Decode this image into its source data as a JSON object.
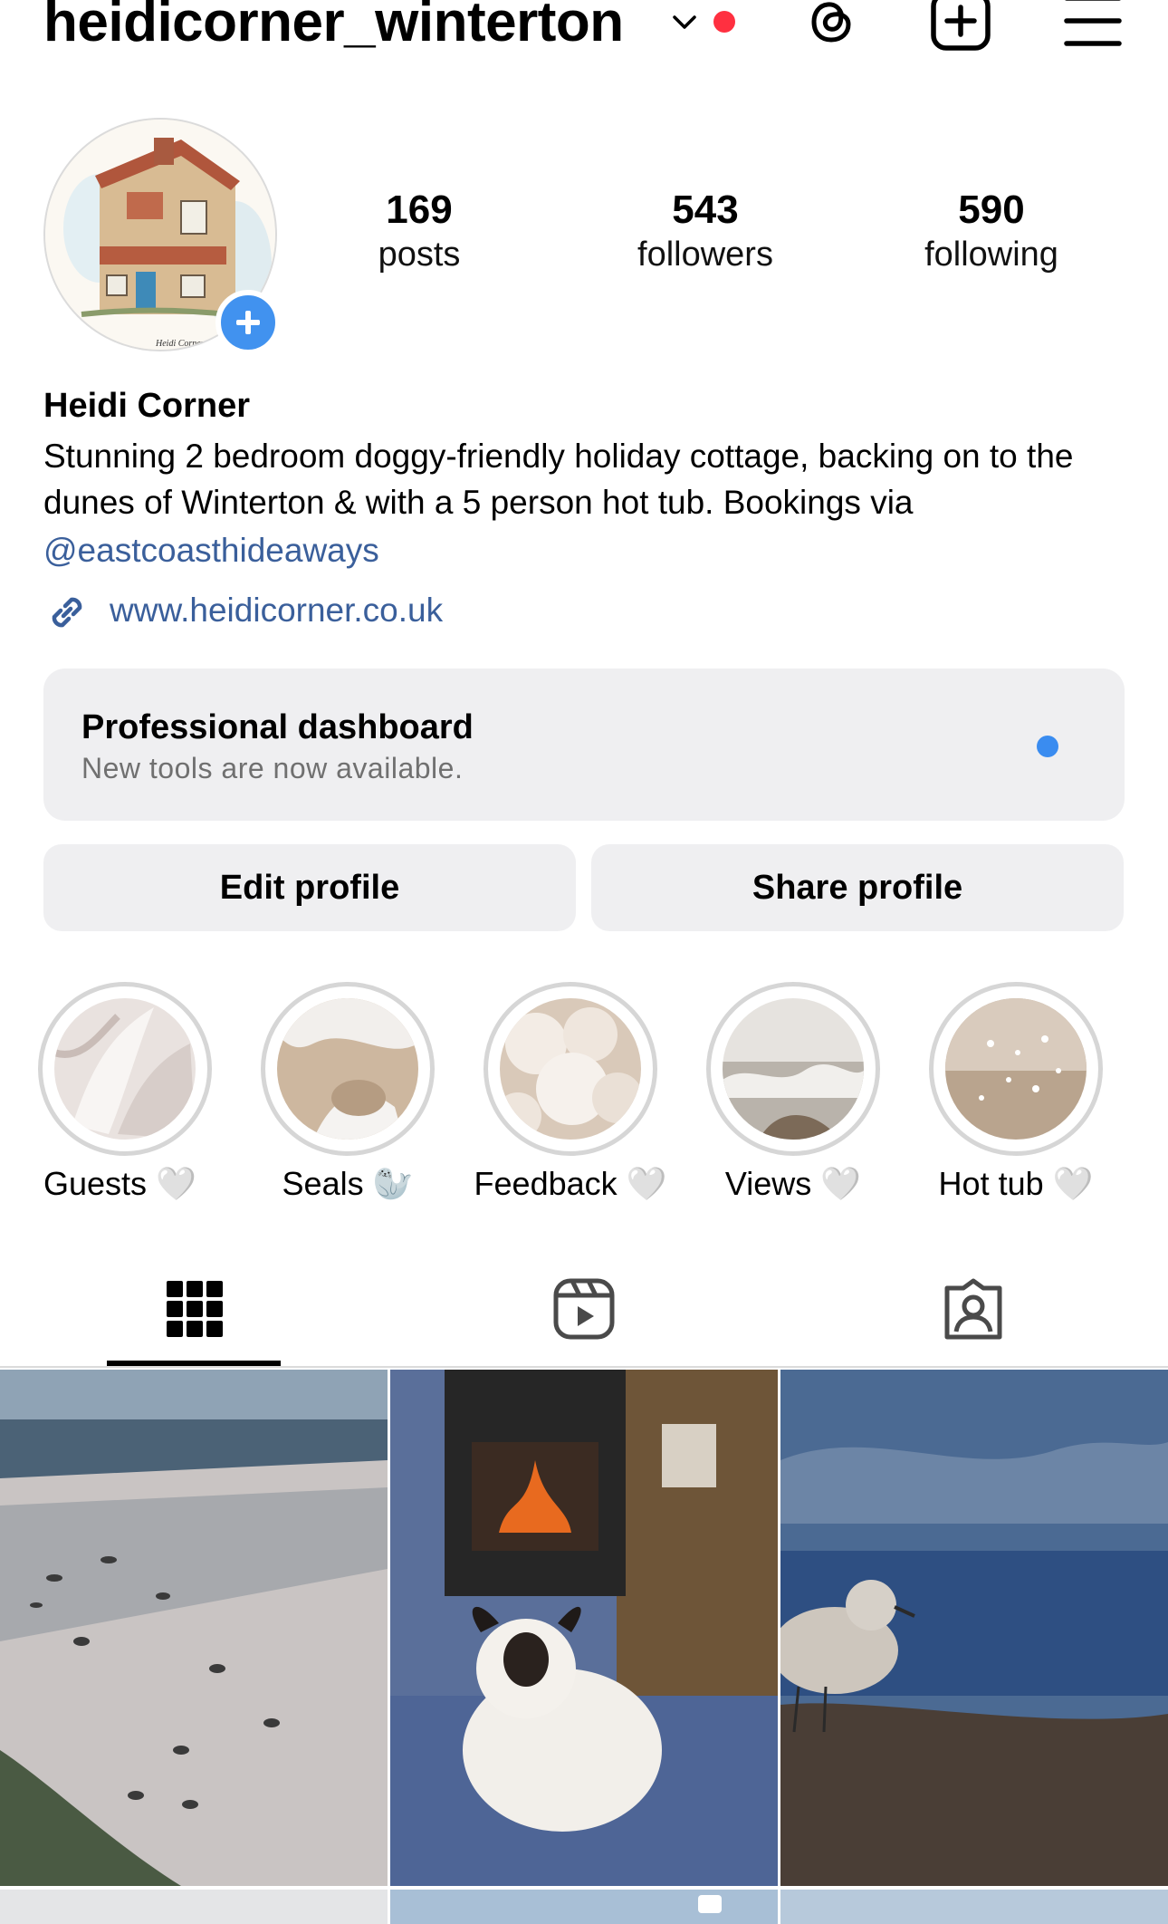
{
  "header": {
    "username": "heidicorner_winterton",
    "icons": [
      "chevron-down-icon",
      "notification-dot",
      "threads-icon",
      "create-post-icon",
      "menu-icon"
    ]
  },
  "profile": {
    "stats": [
      {
        "value": "169",
        "label": "posts"
      },
      {
        "value": "543",
        "label": "followers"
      },
      {
        "value": "590",
        "label": "following"
      }
    ],
    "display_name": "Heidi Corner",
    "bio": "Stunning 2 bedroom doggy-friendly holiday cottage, backing on to the dunes of Winterton & with a 5 person hot tub. Bookings via",
    "mention": "@eastcoasthideaways",
    "website": "www.heidicorner.co.uk"
  },
  "dashboard": {
    "title": "Professional dashboard",
    "subtitle": "New tools are now available."
  },
  "actions": {
    "edit_label": "Edit profile",
    "share_label": "Share profile"
  },
  "highlights": [
    {
      "label": "Guests 🤍"
    },
    {
      "label": "Seals 🦭"
    },
    {
      "label": "Feedback 🤍"
    },
    {
      "label": "Views 🤍"
    },
    {
      "label": "Hot tub 🤍"
    }
  ],
  "tabs": [
    "grid-icon",
    "reels-icon",
    "tagged-icon"
  ],
  "colors": {
    "accent_blue": "#4192ef",
    "link": "#3a5f9b",
    "notification_red": "#ff3040",
    "button_bg": "#efeff1"
  }
}
